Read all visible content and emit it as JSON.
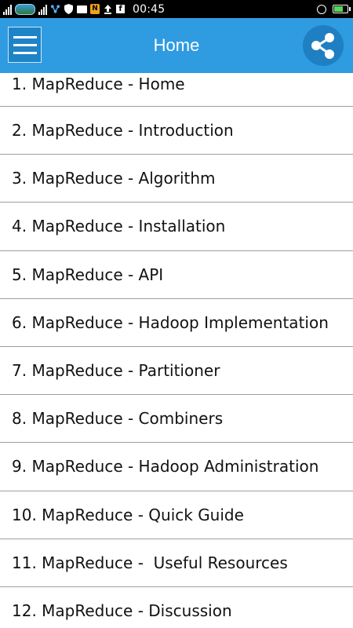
{
  "status_bar": {
    "time": "00:45",
    "battery_level": 0.7,
    "battery_color": "#59d659",
    "icons": [
      "signal-icon",
      "carrier-logo-icon",
      "signal-icon",
      "network-icon",
      "shield-icon",
      "mail-icon",
      "notification-app-icon",
      "upload-icon",
      "facebook-icon",
      "alarm-icon",
      "battery-icon"
    ]
  },
  "app_bar": {
    "title": "Home",
    "background_color": "#2f9be1",
    "menu_icon": "hamburger-menu-icon",
    "share_icon": "share-icon"
  },
  "list": {
    "items": [
      {
        "label": "1. MapReduce - Home"
      },
      {
        "label": "2. MapReduce - Introduction"
      },
      {
        "label": "3. MapReduce - Algorithm"
      },
      {
        "label": "4. MapReduce - Installation"
      },
      {
        "label": "5. MapReduce - API"
      },
      {
        "label": "6. MapReduce - Hadoop Implementation"
      },
      {
        "label": "7. MapReduce - Partitioner"
      },
      {
        "label": "8. MapReduce - Combiners"
      },
      {
        "label": "9. MapReduce - Hadoop Administration"
      },
      {
        "label": "10. MapReduce - Quick Guide"
      },
      {
        "label": "11. MapReduce -  Useful Resources"
      },
      {
        "label": "12. MapReduce - Discussion"
      }
    ]
  }
}
